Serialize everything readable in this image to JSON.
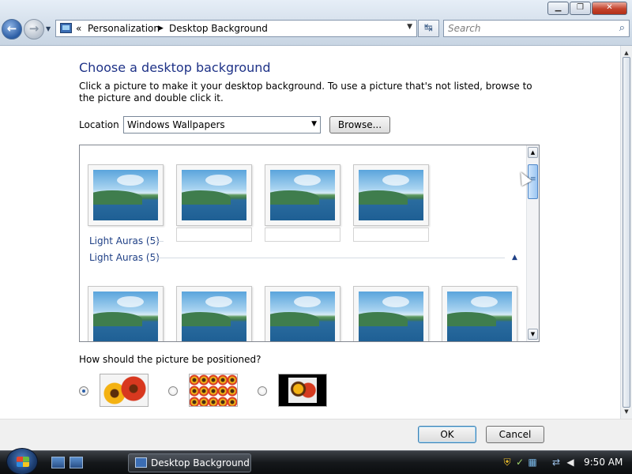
{
  "window": {
    "minimize_label": "▁",
    "maximize_label": "❐",
    "close_label": "✕"
  },
  "nav": {
    "back_glyph": "←",
    "forward_glyph": "→",
    "dropdown_glyph": "▼"
  },
  "address": {
    "overflow": "«",
    "crumbs": [
      "Personalization",
      "Desktop Background"
    ],
    "separator": "▶",
    "dropdown_glyph": "▼",
    "refresh_glyph": "↹"
  },
  "search": {
    "placeholder": "Search",
    "icon": "search-icon",
    "glyph": "⌕"
  },
  "page": {
    "title": "Choose a desktop background",
    "description": "Click a picture to make it your desktop background. To use a picture that's not listed, browse to the picture and double click it."
  },
  "location": {
    "label": "Location",
    "selected": "Windows Wallpapers",
    "dropdown_glyph": "▼",
    "browse_label": "Browse..."
  },
  "picture_list": {
    "groups": [
      {
        "label": "Light Auras (5)"
      },
      {
        "label": "Light Auras (5)",
        "collapse_glyph": "▲"
      }
    ],
    "up_glyph": "▲",
    "down_glyph": "▼"
  },
  "position": {
    "question": "How should the picture be positioned?",
    "options": [
      {
        "name": "fit-to-screen",
        "selected": true
      },
      {
        "name": "tile",
        "selected": false
      },
      {
        "name": "center",
        "selected": false
      }
    ]
  },
  "footer": {
    "ok_label": "OK",
    "cancel_label": "Cancel"
  },
  "taskbar": {
    "window_label": "Desktop Background",
    "clock": "9:50 AM"
  }
}
